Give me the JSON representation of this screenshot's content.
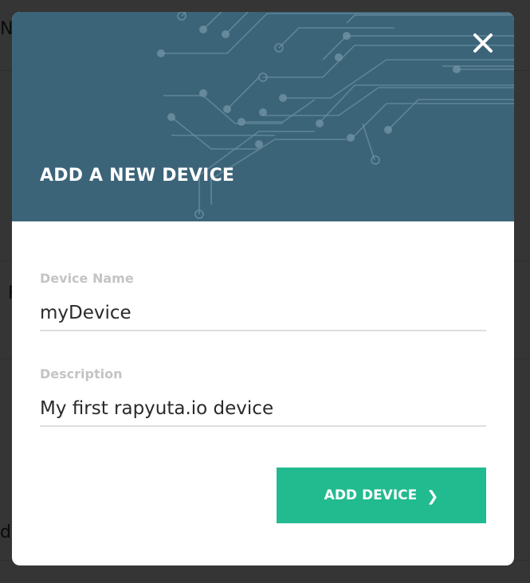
{
  "modal": {
    "title": "ADD A NEW DEVICE",
    "header_color": "#3b6479",
    "close_icon": "close-icon"
  },
  "form": {
    "device_name": {
      "label": "Device Name",
      "value": "myDevice"
    },
    "description": {
      "label": "Description",
      "value": "My first rapyuta.io device"
    }
  },
  "actions": {
    "add_label": "ADD DEVICE",
    "add_icon": "chevron-right-icon",
    "add_color": "#21bb8f"
  },
  "background": {
    "text_top": "Na",
    "text_mid": "F",
    "text_bottom": "d g"
  }
}
